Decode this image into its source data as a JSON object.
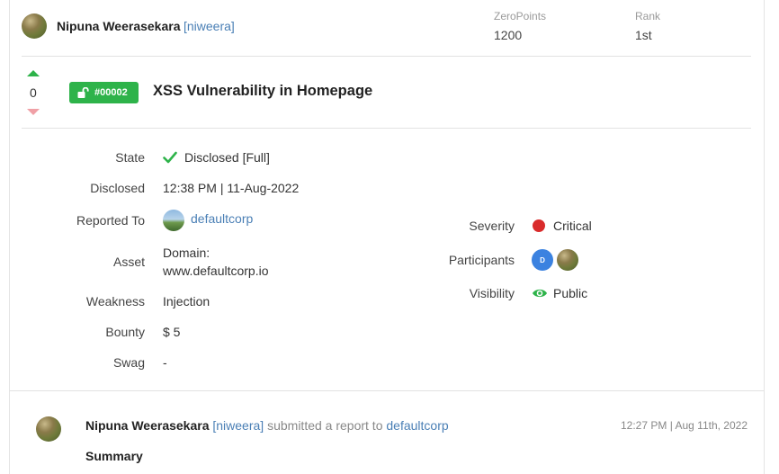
{
  "header": {
    "name": "Nipuna Weerasekara",
    "handle": "[niweera]",
    "zeropoints_label": "ZeroPoints",
    "zeropoints_value": "1200",
    "rank_label": "Rank",
    "rank_value": "1st"
  },
  "report": {
    "vote_count": "0",
    "id": "#00002",
    "title": "XSS Vulnerability in Homepage"
  },
  "details": {
    "state_label": "State",
    "state_value": "Disclosed [Full]",
    "disclosed_label": "Disclosed",
    "disclosed_value": "12:38 PM | 11-Aug-2022",
    "reported_to_label": "Reported To",
    "reported_to_value": "defaultcorp",
    "asset_label": "Asset",
    "asset_line1": "Domain:",
    "asset_line2": "www.defaultcorp.io",
    "weakness_label": "Weakness",
    "weakness_value": "Injection",
    "bounty_label": "Bounty",
    "bounty_value": "$ 5",
    "swag_label": "Swag",
    "swag_value": "-",
    "severity_label": "Severity",
    "severity_value": "Critical",
    "participants_label": "Participants",
    "participant_initial": "D",
    "visibility_label": "Visibility",
    "visibility_value": "Public"
  },
  "activity": {
    "name": "Nipuna Weerasekara",
    "handle": "[niweera]",
    "action": "submitted a report to",
    "target": "defaultcorp",
    "time": "12:27 PM | Aug 11th, 2022",
    "summary_heading": "Summary"
  },
  "colors": {
    "accent_green": "#2eb34a",
    "link_blue": "#4a7fb5",
    "severity_red": "#d92b2b",
    "participant_blue": "#3b82e0"
  }
}
